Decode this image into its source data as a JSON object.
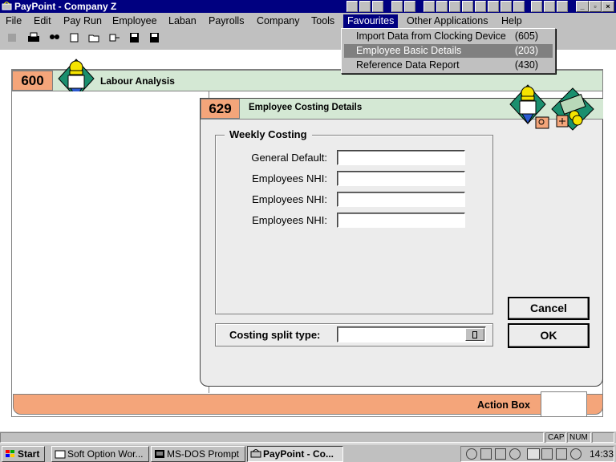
{
  "app": {
    "title": "PayPoint - Company Z"
  },
  "menu": {
    "items": [
      "File",
      "Edit",
      "Pay Run",
      "Employee",
      "Laban",
      "Payrolls",
      "Company",
      "Tools",
      "Favourites",
      "Other Applications",
      "Help"
    ],
    "active": "Favourites"
  },
  "favourites_menu": {
    "items": [
      {
        "label": "Import Data from Clocking Device",
        "code": "(605)"
      },
      {
        "label": "Employee Basic Details",
        "code": "(203)"
      },
      {
        "label": "Reference Data Report",
        "code": "(430)"
      }
    ],
    "highlighted": "Employee Basic Details"
  },
  "window600": {
    "number": "600",
    "title": "Labour Analysis"
  },
  "window629": {
    "number": "629",
    "title": "Employee Costing Details",
    "group_title": "Weekly Costing",
    "fields": [
      {
        "label": "General Default:",
        "value": ""
      },
      {
        "label": "Employees NHI:",
        "value": ""
      },
      {
        "label": "Employees NHI:",
        "value": ""
      },
      {
        "label": "Employees NHI:",
        "value": ""
      }
    ],
    "split_label": "Costing split type:",
    "split_value": "",
    "cancel_label": "Cancel",
    "ok_label": "OK"
  },
  "action_box": {
    "label": "Action Box"
  },
  "status": {
    "caps": "CAP",
    "num": "NUM"
  },
  "taskbar": {
    "start": "Start",
    "items": [
      {
        "label": "Soft Option Wor...",
        "icon": "app-icon"
      },
      {
        "label": "MS-DOS Prompt",
        "icon": "msdos-icon"
      },
      {
        "label": "PayPoint - Co...",
        "icon": "paypoint-icon",
        "active": true
      }
    ],
    "clock": "14:33"
  },
  "colors": {
    "titlebar": "#000080",
    "header_green": "#d4e8d4",
    "number_orange": "#f4a57a",
    "menu_highlight": "#808080"
  }
}
